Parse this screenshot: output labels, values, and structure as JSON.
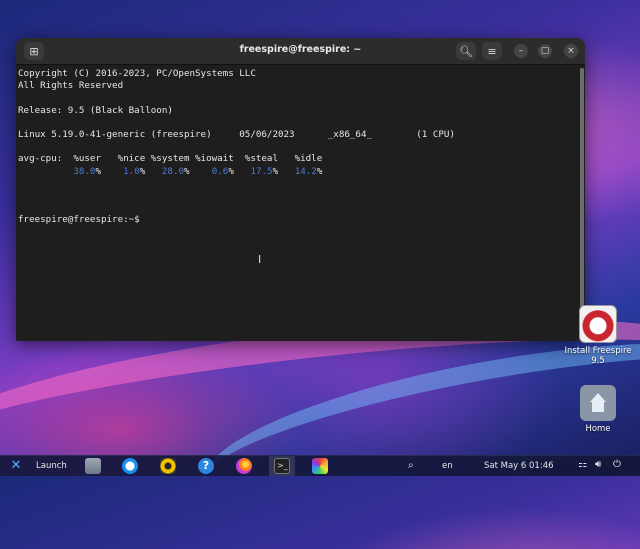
{
  "window": {
    "title": "freespire@freespire: ~"
  },
  "terminal": {
    "lines": [
      "Copyright (C) 2016-2023, PC/OpenSystems LLC",
      "All Rights Reserved",
      "",
      "Release: 9.5 (Black Balloon)",
      "",
      "Linux 5.19.0-41-generic (freespire)     05/06/2023      _x86_64_        (1 CPU)",
      "",
      "avg-cpu:  %user   %nice %system %iowait  %steal   %idle"
    ],
    "cpu_values": [
      "38.0",
      "1.0",
      "28.0",
      "0.6",
      "17.5",
      "14.2"
    ],
    "prompt": "freespire@freespire:~$"
  },
  "desktop": {
    "install_label": "Install Freespire 9.5",
    "home_label": "Home"
  },
  "taskbar": {
    "launch_label": "Launch",
    "lang": "en",
    "clock": "Sat May 6  01:46"
  },
  "icons": {
    "new_tab": "new-tab-icon",
    "search": "search-icon",
    "menu": "hamburger-menu-icon",
    "minimize": "minimize-icon",
    "maximize": "maximize-icon",
    "close": "close-icon"
  }
}
